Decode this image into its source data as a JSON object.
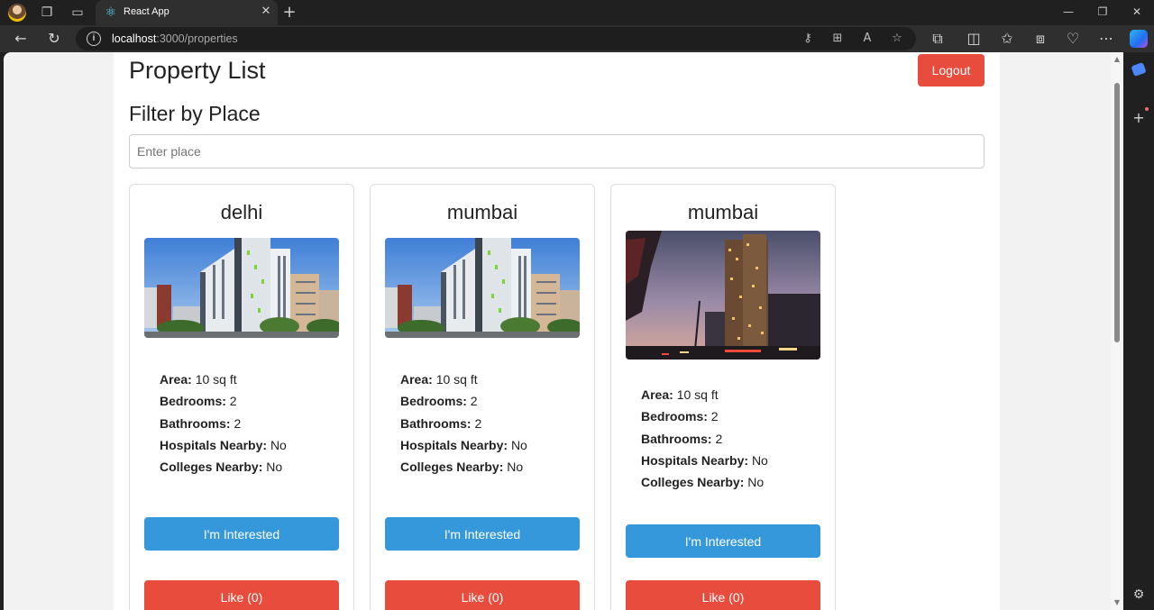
{
  "browser": {
    "tab_title": "React App",
    "url_host": "localhost",
    "url_path": ":3000/properties",
    "icons": {
      "profile": "profile-avatar",
      "workspaces": "workspaces-icon",
      "tab_actions": "tab-actions-icon",
      "favicon": "react-icon",
      "close_tab": "close-icon",
      "new_tab": "plus-icon",
      "back": "back-arrow-icon",
      "refresh": "refresh-icon",
      "site_info": "info-icon",
      "key": "key-icon",
      "apps": "apps-icon",
      "read_aloud": "read-aloud-icon",
      "favorite": "star-icon",
      "extensions": "puzzle-icon",
      "split": "split-screen-icon",
      "favorites": "favorites-icon",
      "collections": "collections-icon",
      "health": "browser-essentials-icon",
      "more": "more-icon",
      "copilot": "copilot-icon"
    },
    "glyphs": {
      "workspaces": "❐",
      "tab_actions": "▭",
      "favicon": "⚛",
      "close": "✕",
      "new_tab": "+",
      "minimize": "—",
      "restore": "❐",
      "close_window": "✕",
      "back": "←",
      "refresh": "↻",
      "info": "i",
      "key": "⚷",
      "apps": "⊞",
      "read_aloud": "A",
      "star": "☆",
      "puzzle": "⧉",
      "split": "◫",
      "favorites": "✩",
      "collections": "⧈",
      "health": "♡",
      "more": "⋯",
      "side_plus": "+",
      "settings": "⚙",
      "scroll_up": "▲",
      "scroll_down": "▼"
    }
  },
  "page": {
    "title": "Property List",
    "logout_label": "Logout",
    "filter_heading": "Filter by Place",
    "filter_placeholder": "Enter place"
  },
  "properties": [
    {
      "place": "delhi",
      "image": "modern-apartment-buildings-photo",
      "area_label": "Area:",
      "area": "10 sq ft",
      "bedrooms_label": "Bedrooms:",
      "bedrooms": "2",
      "bathrooms_label": "Bathrooms:",
      "bathrooms": "2",
      "hospitals_label": "Hospitals Nearby:",
      "hospitals": "No",
      "colleges_label": "Colleges Nearby:",
      "colleges": "No",
      "interest_label": "I'm Interested",
      "like_label": "Like (0)"
    },
    {
      "place": "mumbai",
      "image": "modern-apartment-buildings-photo",
      "area_label": "Area:",
      "area": "10 sq ft",
      "bedrooms_label": "Bedrooms:",
      "bedrooms": "2",
      "bathrooms_label": "Bathrooms:",
      "bathrooms": "2",
      "hospitals_label": "Hospitals Nearby:",
      "hospitals": "No",
      "colleges_label": "Colleges Nearby:",
      "colleges": "No",
      "interest_label": "I'm Interested",
      "like_label": "Like (0)"
    },
    {
      "place": "mumbai",
      "image": "tower-at-dusk-photo",
      "area_label": "Area:",
      "area": "10 sq ft",
      "bedrooms_label": "Bedrooms:",
      "bedrooms": "2",
      "bathrooms_label": "Bathrooms:",
      "bathrooms": "2",
      "hospitals_label": "Hospitals Nearby:",
      "hospitals": "No",
      "colleges_label": "Colleges Nearby:",
      "colleges": "No",
      "interest_label": "I'm Interested",
      "like_label": "Like (0)"
    }
  ],
  "colors": {
    "interest_button": "#3498db",
    "like_button": "#e74c3c",
    "logout_button": "#e74c3c"
  }
}
